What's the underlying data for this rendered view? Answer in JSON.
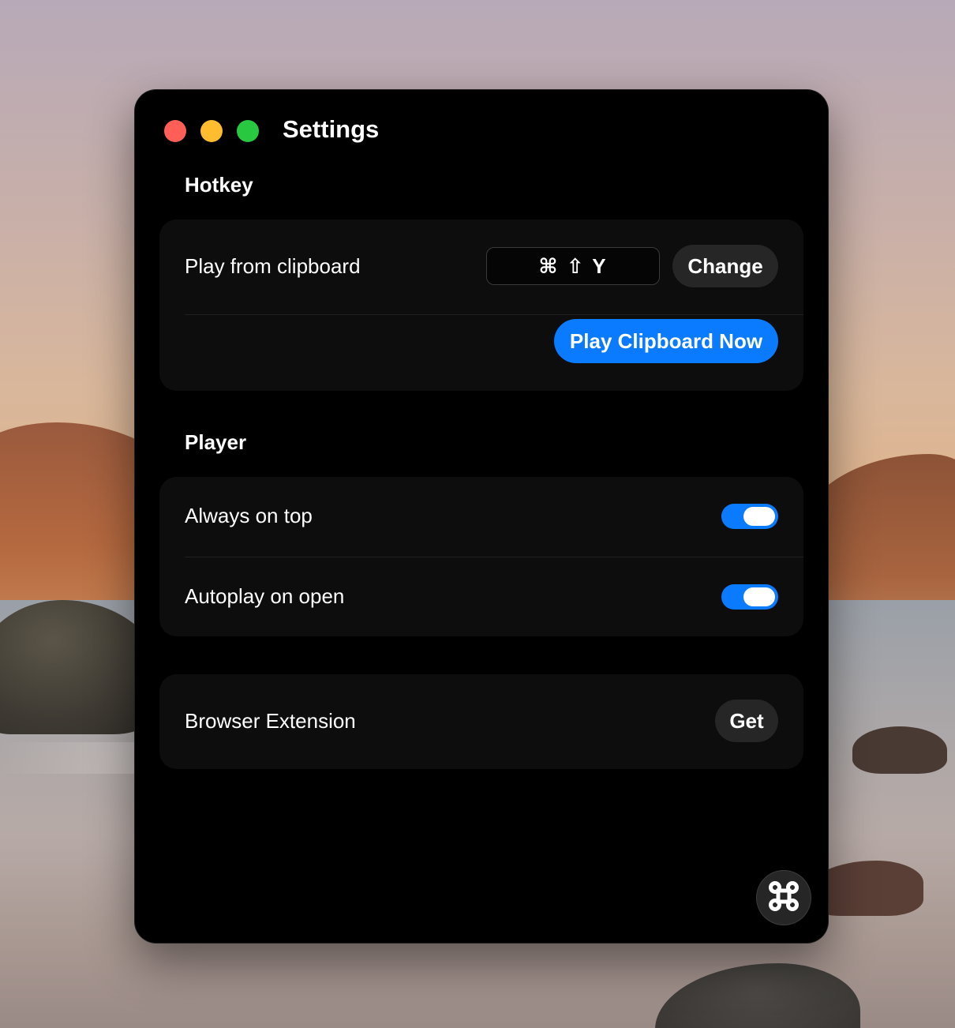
{
  "window": {
    "title": "Settings"
  },
  "hotkey": {
    "section_title": "Hotkey",
    "play_from_clipboard_label": "Play from clipboard",
    "shortcut": "⌘ ⇧ Y",
    "change_label": "Change",
    "play_now_label": "Play Clipboard Now"
  },
  "player": {
    "section_title": "Player",
    "always_on_top": {
      "label": "Always on top",
      "enabled": true
    },
    "autoplay_on_open": {
      "label": "Autoplay on open",
      "enabled": true
    }
  },
  "extension": {
    "label": "Browser Extension",
    "get_label": "Get"
  },
  "icons": {
    "fab": "command-icon"
  },
  "colors": {
    "accent": "#0a7aff",
    "window_bg": "#000000",
    "card_bg": "#0d0d0d",
    "traffic_red": "#ff5f57",
    "traffic_yellow": "#febc2e",
    "traffic_green": "#28c840"
  }
}
